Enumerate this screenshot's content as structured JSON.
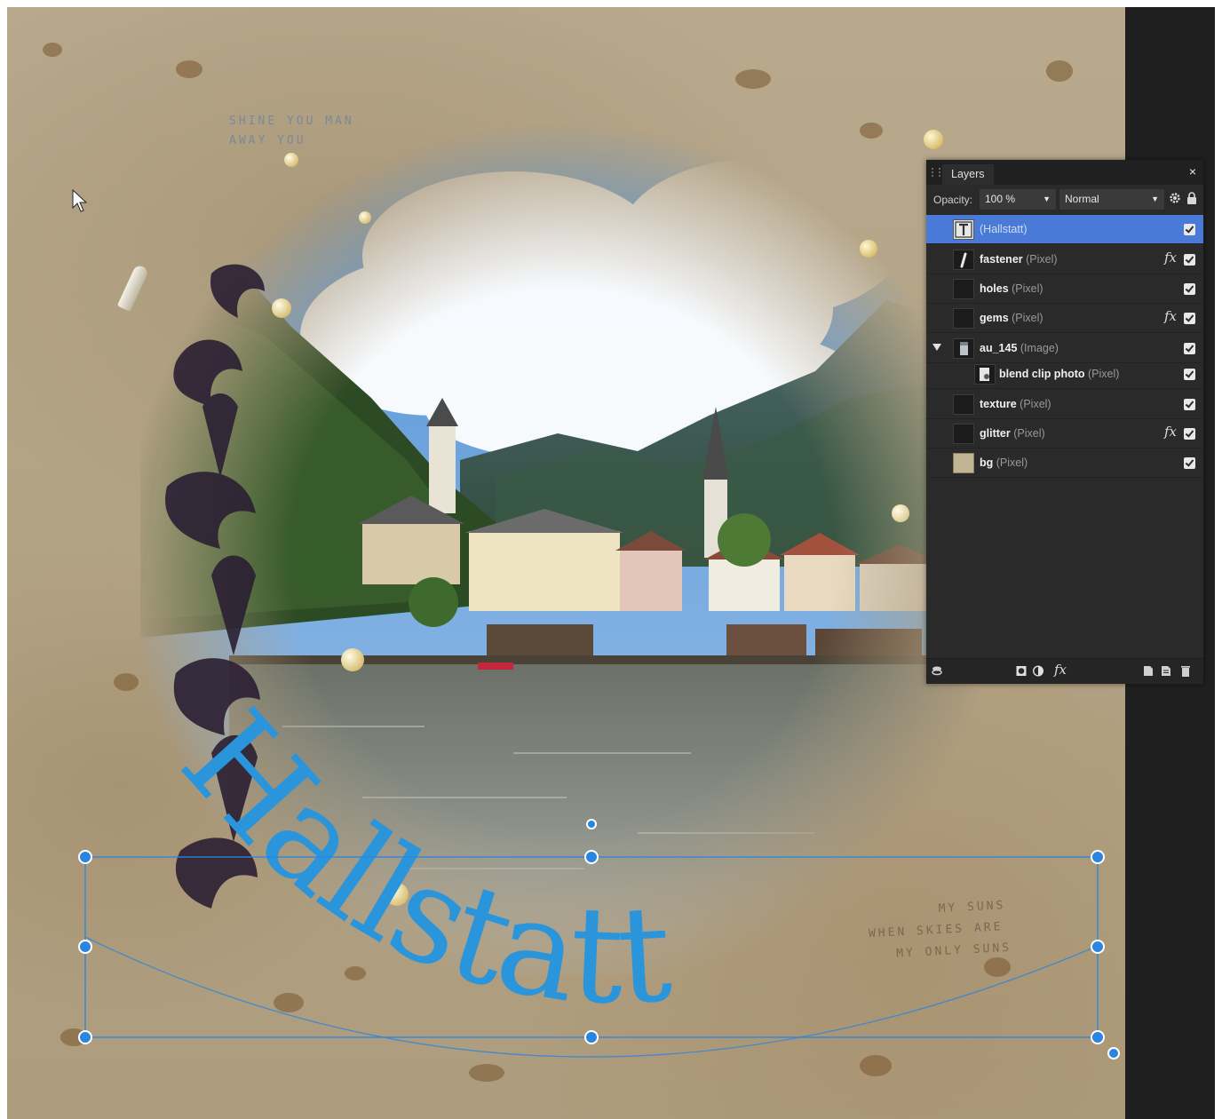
{
  "canvas": {
    "stamp_text_top": [
      "SHINE YOU MAN",
      "AWAY YOU"
    ],
    "stamp_text_bottom": [
      "MY SUNS",
      "WHEN SKIES ARE",
      "MY ONLY SUNS"
    ],
    "art_text": "Hallstatt"
  },
  "layers_panel": {
    "tab_label": "Layers",
    "close_icon": "×",
    "opacity_label": "Opacity:",
    "opacity_value": "100 %",
    "blend_mode": "Normal",
    "layers": [
      {
        "name": "(Hallstatt)",
        "type": "",
        "thumb": "text-layer-icon",
        "selected": true,
        "fx": false,
        "visible": true
      },
      {
        "name": "fastener",
        "type": "(Pixel)",
        "thumb": "fastener-thumb",
        "selected": false,
        "fx": true,
        "visible": true
      },
      {
        "name": "holes",
        "type": "(Pixel)",
        "thumb": "holes-thumb",
        "selected": false,
        "fx": false,
        "visible": true
      },
      {
        "name": "gems",
        "type": "(Pixel)",
        "thumb": "gems-thumb",
        "selected": false,
        "fx": true,
        "visible": true
      },
      {
        "name": "au_145",
        "type": "(Image)",
        "thumb": "image-thumb",
        "selected": false,
        "fx": false,
        "visible": true,
        "expanded": true
      },
      {
        "name": "blend clip photo",
        "type": "(Pixel)",
        "thumb": "clip-photo-thumb",
        "selected": false,
        "fx": false,
        "visible": true,
        "child": true
      },
      {
        "name": "texture",
        "type": "(Pixel)",
        "thumb": "texture-thumb",
        "selected": false,
        "fx": false,
        "visible": true
      },
      {
        "name": "glitter",
        "type": "(Pixel)",
        "thumb": "glitter-thumb",
        "selected": false,
        "fx": true,
        "visible": true
      },
      {
        "name": "bg",
        "type": "(Pixel)",
        "thumb": "bg-thumb",
        "selected": false,
        "fx": false,
        "visible": true
      }
    ],
    "fx_label": "fx",
    "footer_icons": [
      "layer-stack-icon",
      "mask-icon",
      "adjustment-icon",
      "fx-icon",
      "new-layer-icon",
      "duplicate-layer-icon",
      "delete-layer-icon"
    ]
  },
  "colors": {
    "selection_blue": "#4a7ad8",
    "text_blue": "#2a95db",
    "handle_blue": "#2a85e0",
    "panel_bg": "#2a2a2a"
  }
}
